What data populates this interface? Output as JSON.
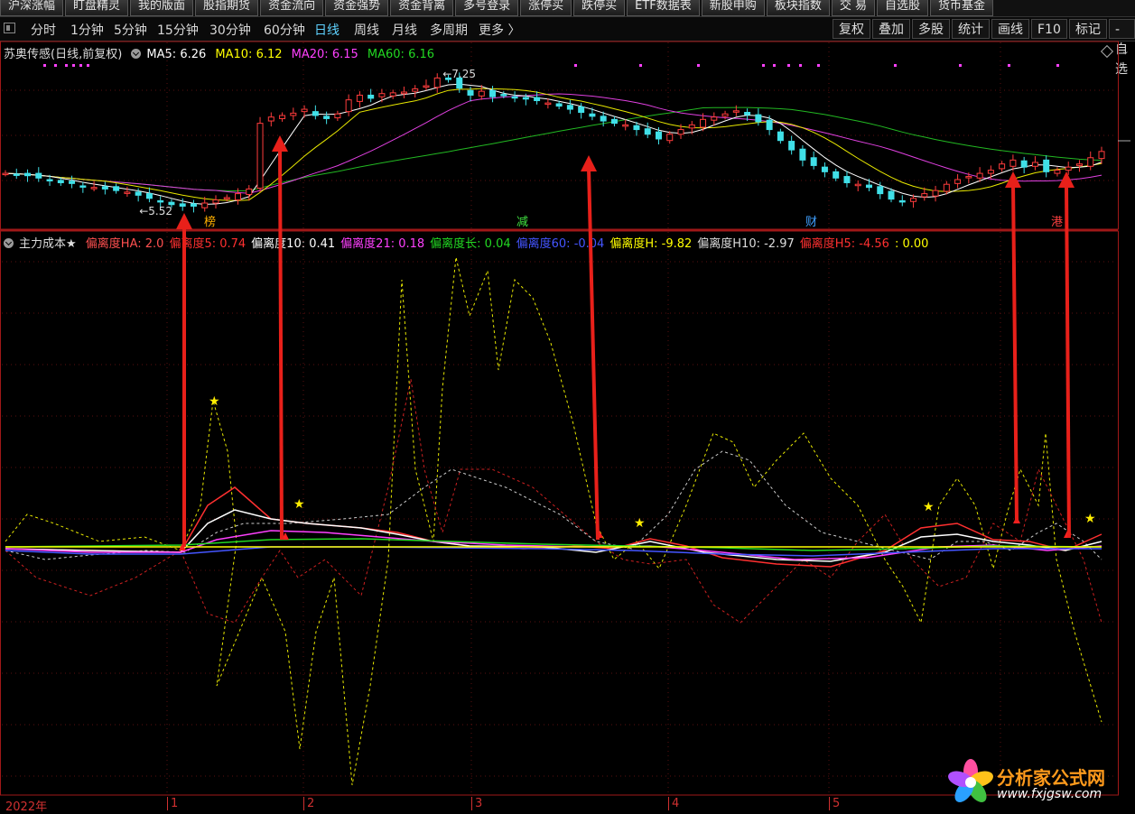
{
  "toolbar": {
    "buttons": [
      "沪深涨幅",
      "盯盘精灵",
      "我的版面",
      "股指期货",
      "资金流向",
      "资金强势",
      "资金背离",
      "多号登录",
      "涨停买",
      "跌停买",
      "ETF数据表",
      "新股申购",
      "板块指数",
      "交 易",
      "自选股",
      "货币基金"
    ]
  },
  "periods": {
    "items": [
      "分时",
      "1分钟",
      "5分钟",
      "15分钟",
      "30分钟",
      "60分钟",
      "日线",
      "周线",
      "月线",
      "多周期",
      "更多 〉"
    ],
    "active": "日线",
    "right_buttons": [
      "复权",
      "叠加",
      "多股",
      "统计",
      "画线",
      "F10",
      "标记",
      "-自选"
    ]
  },
  "main_legend": {
    "title": "苏奥传感(日线,前复权)",
    "ma5": "MA5: 6.26",
    "ma10": "MA10: 6.12",
    "ma20": "MA20: 6.15",
    "ma60": "MA60: 6.16",
    "high_label": "7.25",
    "low_label": "5.52",
    "colors": {
      "ma5": "#ffffff",
      "ma10": "#ffff00",
      "ma20": "#ff40ff",
      "ma60": "#22d822"
    }
  },
  "markers": [
    "榜",
    "减",
    "财",
    "港"
  ],
  "sub_legend": {
    "title": "主力成本★",
    "items": [
      {
        "text": "偏离度HA: 2.0",
        "color": "#ff5050"
      },
      {
        "text": "偏离度5: 0.74",
        "color": "#ff3030"
      },
      {
        "text": "偏离度10: 0.41",
        "color": "#ffffff"
      },
      {
        "text": "偏离度21: 0.18",
        "color": "#ff40ff"
      },
      {
        "text": "偏离度长: 0.04",
        "color": "#22d822"
      },
      {
        "text": "偏离度60: -0.04",
        "color": "#4455ff"
      },
      {
        "text": "偏离度H: -9.82",
        "color": "#ffff00"
      },
      {
        "text": "偏离度H10: -2.97",
        "color": "#dddddd"
      },
      {
        "text": "偏离度H5: -4.56",
        "color": "#ff3030"
      },
      {
        "text": ": 0.00",
        "color": "#ffff00"
      }
    ]
  },
  "date_axis": {
    "year": "2022年",
    "months": [
      "1",
      "2",
      "3",
      "4",
      "5"
    ]
  },
  "watermark": {
    "name": "分析家公式网",
    "url": "www.fxjgsw.com"
  },
  "chart_data": {
    "type": "candlestick",
    "stock": "苏奥传感",
    "period": "日线",
    "price_labels": {
      "high": 7.25,
      "low": 5.52
    },
    "moving_averages": {
      "MA5": 6.26,
      "MA10": 6.12,
      "MA20": 6.15,
      "MA60": 6.16
    },
    "close_series": [
      5.98,
      5.97,
      5.95,
      5.92,
      5.89,
      5.86,
      5.85,
      5.81,
      5.8,
      5.78,
      5.76,
      5.74,
      5.7,
      5.66,
      5.62,
      5.58,
      5.56,
      5.56,
      5.6,
      5.64,
      5.67,
      5.72,
      5.78,
      6.62,
      6.7,
      6.72,
      6.75,
      6.8,
      6.72,
      6.68,
      6.74,
      6.92,
      6.98,
      6.94,
      7.0,
      7.01,
      7.02,
      7.06,
      7.1,
      7.2,
      7.18,
      7.07,
      6.98,
      7.03,
      6.96,
      6.98,
      6.95,
      6.93,
      6.91,
      6.88,
      6.84,
      6.8,
      6.76,
      6.71,
      6.65,
      6.62,
      6.6,
      6.54,
      6.48,
      6.42,
      6.48,
      6.54,
      6.6,
      6.67,
      6.7,
      6.74,
      6.78,
      6.73,
      6.64,
      6.54,
      6.4,
      6.28,
      6.15,
      6.08,
      6.0,
      5.92,
      5.86,
      5.84,
      5.8,
      5.72,
      5.65,
      5.62,
      5.66,
      5.72,
      5.76,
      5.84,
      5.9,
      5.94,
      5.98,
      6.02,
      6.1,
      6.15,
      6.06,
      6.12,
      6.0,
      6.02,
      6.06,
      6.1,
      6.18,
      6.26
    ],
    "indicator": {
      "name": "主力成本★",
      "series": [
        "偏离度HA",
        "偏离度5",
        "偏离度10",
        "偏离度21",
        "偏离度长",
        "偏离度60",
        "偏离度H",
        "偏离度H10",
        "偏离度H5"
      ],
      "last_values": [
        2.0,
        0.74,
        0.41,
        0.18,
        0.04,
        -0.04,
        -9.82,
        -2.97,
        -4.56
      ]
    },
    "x_axis": [
      "2022年",
      "1",
      "2",
      "3",
      "4",
      "5"
    ]
  }
}
